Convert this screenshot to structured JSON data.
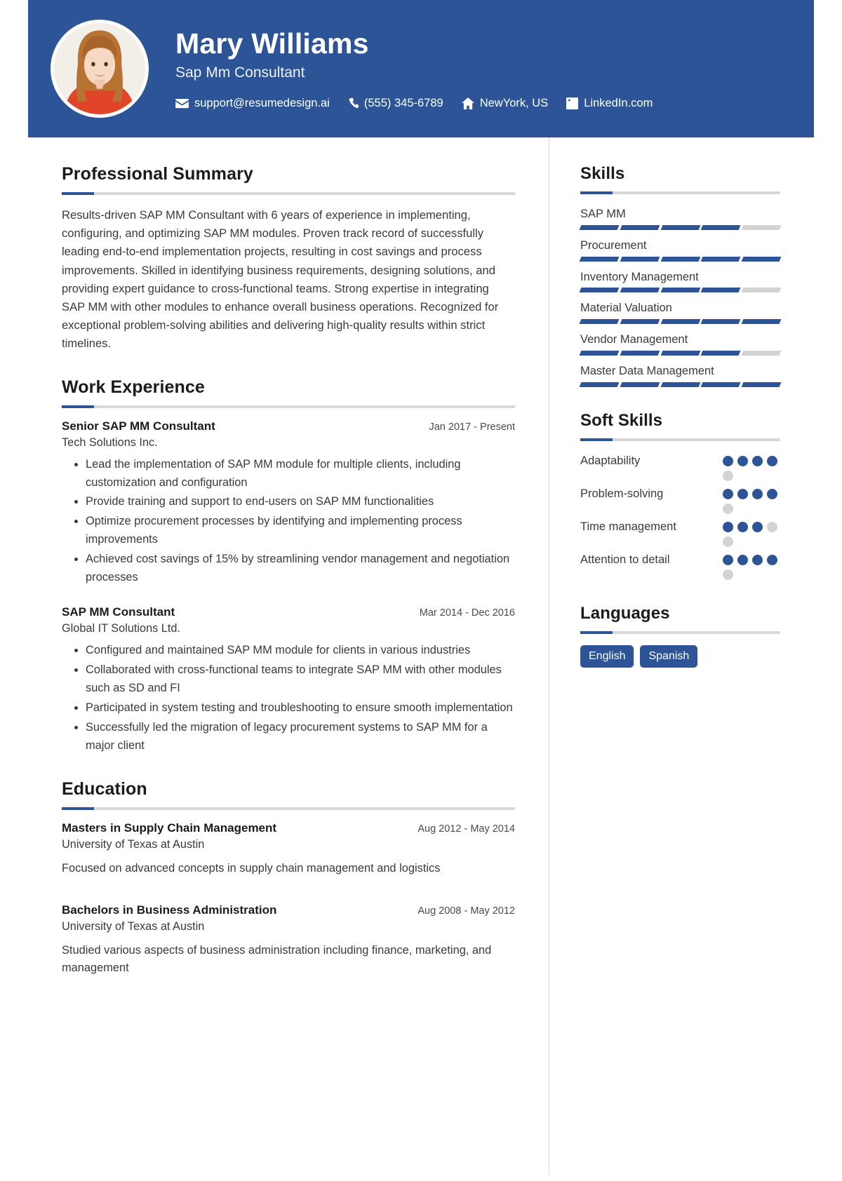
{
  "header": {
    "name": "Mary Williams",
    "role": "Sap Mm Consultant",
    "accent_color": "#2d5496",
    "contacts": [
      {
        "icon": "envelope-icon",
        "label": "support@resumedesign.ai"
      },
      {
        "icon": "phone-icon",
        "label": "(555) 345-6789"
      },
      {
        "icon": "home-icon",
        "label": "NewYork, US"
      },
      {
        "icon": "linkedin-icon",
        "label": "LinkedIn.com"
      }
    ]
  },
  "summary": {
    "title": "Professional Summary",
    "text": "Results-driven SAP MM Consultant with 6 years of experience in implementing, configuring, and optimizing SAP MM modules. Proven track record of successfully leading end-to-end implementation projects, resulting in cost savings and process improvements. Skilled in identifying business requirements, designing solutions, and providing expert guidance to cross-functional teams. Strong expertise in integrating SAP MM with other modules to enhance overall business operations. Recognized for exceptional problem-solving abilities and delivering high-quality results within strict timelines."
  },
  "experience": {
    "title": "Work Experience",
    "entries": [
      {
        "title": "Senior SAP MM Consultant",
        "date": "Jan 2017 - Present",
        "organization": "Tech Solutions Inc.",
        "bullets": [
          "Lead the implementation of SAP MM module for multiple clients, including customization and configuration",
          "Provide training and support to end-users on SAP MM functionalities",
          "Optimize procurement processes by identifying and implementing process improvements",
          "Achieved cost savings of 15% by streamlining vendor management and negotiation processes"
        ]
      },
      {
        "title": "SAP MM Consultant",
        "date": "Mar 2014 - Dec 2016",
        "organization": "Global IT Solutions Ltd.",
        "bullets": [
          "Configured and maintained SAP MM module for clients in various industries",
          "Collaborated with cross-functional teams to integrate SAP MM with other modules such as SD and FI",
          "Participated in system testing and troubleshooting to ensure smooth implementation",
          "Successfully led the migration of legacy procurement systems to SAP MM for a major client"
        ]
      }
    ]
  },
  "education": {
    "title": "Education",
    "entries": [
      {
        "degree": "Masters in Supply Chain Management",
        "date": "Aug 2012 - May 2014",
        "school": "University of Texas at Austin",
        "note": "Focused on advanced concepts in supply chain management and logistics"
      },
      {
        "degree": "Bachelors in Business Administration",
        "date": "Aug 2008 - May 2012",
        "school": "University of Texas at Austin",
        "note": "Studied various aspects of business administration including finance, marketing, and management"
      }
    ]
  },
  "skills": {
    "title": "Skills",
    "segments_total": 5,
    "items": [
      {
        "name": "SAP MM",
        "level": 4
      },
      {
        "name": "Procurement",
        "level": 5
      },
      {
        "name": "Inventory Management",
        "level": 4
      },
      {
        "name": "Material Valuation",
        "level": 5
      },
      {
        "name": "Vendor Management",
        "level": 4
      },
      {
        "name": "Master Data Management",
        "level": 5
      }
    ]
  },
  "soft_skills": {
    "title": "Soft Skills",
    "dots_total": 5,
    "items": [
      {
        "name": "Adaptability",
        "level": 4
      },
      {
        "name": "Problem-solving",
        "level": 4
      },
      {
        "name": "Time management",
        "level": 3
      },
      {
        "name": "Attention to detail",
        "level": 4
      }
    ]
  },
  "languages": {
    "title": "Languages",
    "items": [
      "English",
      "Spanish"
    ]
  }
}
